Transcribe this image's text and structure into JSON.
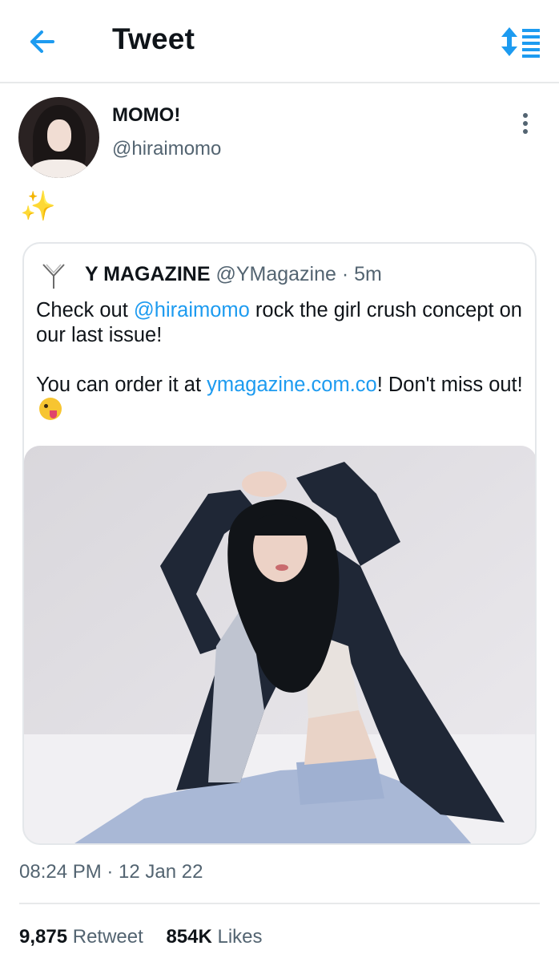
{
  "header": {
    "title": "Tweet",
    "back_icon": "arrow-left-icon",
    "sort_icon": "sort-list-icon",
    "accent_color": "#1d9bf0"
  },
  "tweet": {
    "author_name": "MOMO!",
    "author_handle": "@hiraimomo",
    "text": "✨",
    "timestamp": "08:24 PM · 12 Jan 22",
    "more_icon": "more-vertical-icon"
  },
  "quoted_tweet": {
    "author_name": "Y MAGAZINE",
    "author_handle": "@YMagazine",
    "separator": "·",
    "age": "5m",
    "line1_prefix": "Check out ",
    "line1_mention": "@hiraimomo",
    "line1_suffix": " rock the girl crush concept on our last issue!",
    "line2_prefix": "You can order it at ",
    "line2_link": "ymagazine.com.co",
    "line2_suffix": "! Don't miss out!",
    "emoji_icon": "winking-tongue-emoji-icon"
  },
  "stats": {
    "retweets_count": "9,875",
    "retweets_label": "Retweet",
    "likes_count": "854K",
    "likes_label": "Likes"
  }
}
